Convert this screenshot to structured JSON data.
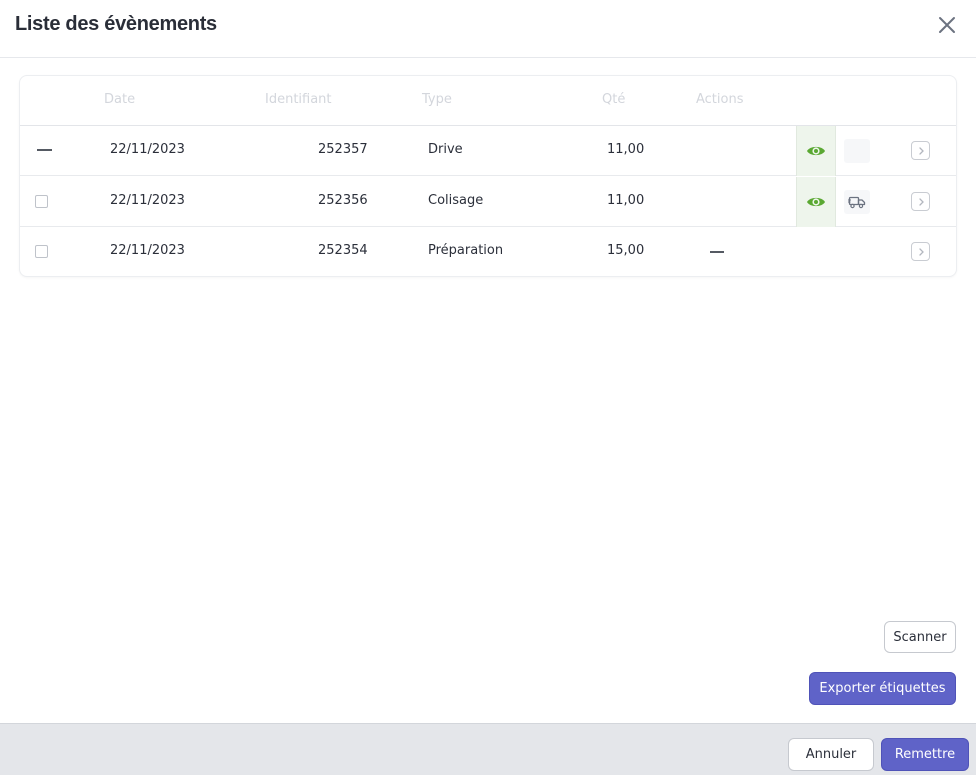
{
  "modal": {
    "title": "Liste des évènements"
  },
  "table": {
    "columns": [
      "Date",
      "Identifiant",
      "Type",
      "Qté",
      "Actions"
    ],
    "rows": [
      {
        "date": "22/11/2023",
        "id": "252357",
        "type": "Drive",
        "qty": "11,00"
      },
      {
        "date": "22/11/2023",
        "id": "252356",
        "type": "Colisage",
        "qty": "11,00"
      },
      {
        "date": "22/11/2023",
        "id": "252354",
        "type": "Préparation",
        "qty": "15,00"
      }
    ]
  },
  "buttons": {
    "scanner": "Scanner",
    "export": "Exporter étiquettes",
    "cancel": "Annuler",
    "submit": "Remettre"
  },
  "icons": {
    "close": "close-icon",
    "eye": "eye-icon",
    "truck": "truck-icon",
    "chevron": "chevron-right-icon"
  },
  "colors": {
    "primary": "#5f63c8",
    "eye_green": "#5aa832",
    "footer_bg": "#e4e6ea"
  }
}
